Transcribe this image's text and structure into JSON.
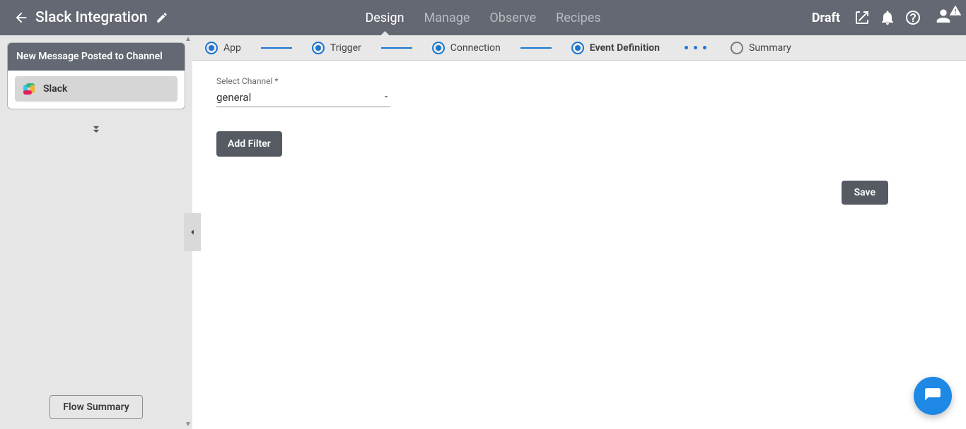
{
  "header": {
    "title": "Slack Integration",
    "status": "Draft",
    "tabs": [
      "Design",
      "Manage",
      "Observe",
      "Recipes"
    ],
    "active_tab_index": 0
  },
  "sidebar": {
    "card_title": "New Message Posted to Channel",
    "app_label": "Slack",
    "flow_summary_label": "Flow Summary"
  },
  "stepper": {
    "steps": [
      {
        "label": "App",
        "state": "done"
      },
      {
        "label": "Trigger",
        "state": "done"
      },
      {
        "label": "Connection",
        "state": "done"
      },
      {
        "label": "Event Definition",
        "state": "active"
      },
      {
        "label": "Summary",
        "state": "pending"
      }
    ]
  },
  "form": {
    "channel_label": "Select Channel *",
    "channel_value": "general",
    "add_filter_label": "Add Filter",
    "save_label": "Save"
  }
}
